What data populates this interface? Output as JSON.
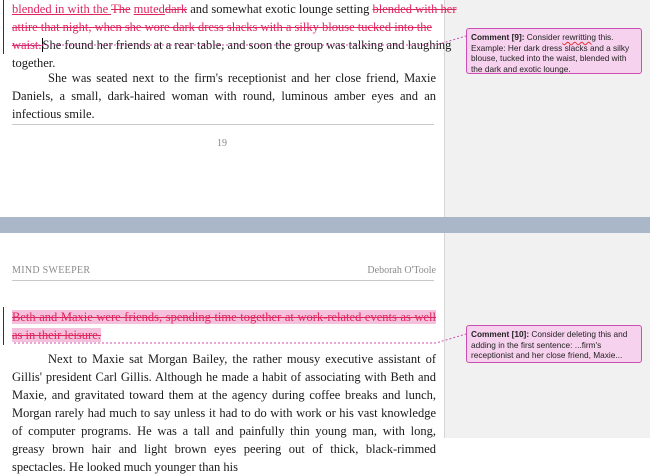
{
  "page1": {
    "line1": {
      "pre_ins": "blended in with the ",
      "del_the": "The",
      "sp": " ",
      "ins_muted": "muted",
      "del_dark": "dark",
      "rest": " and somewhat exotic lounge setting",
      "del_tail": "blended with her"
    },
    "line2_del": "attire that night, when she wore dark dress slacks with a silky blouse tucked into the",
    "line3": {
      "del": "waist.",
      "text": "She found her friends at a rear table, and soon the group was talking and laughing"
    },
    "line4": "together.",
    "para2": "She was seated next to the firm's receptionist and her close friend, Maxie Daniels, a small, dark-haired woman with round, luminous amber eyes and an infectious smile.",
    "page_number": "19"
  },
  "page2": {
    "header_left": "MIND SWEEPER",
    "header_right": "Deborah O'Toole",
    "deleted_para": "Beth and Maxie were friends, spending time together at work-related events as well as in their leisure.",
    "para": "Next to Maxie sat Morgan Bailey, the rather mousy executive assistant of Gillis' president Carl Gillis. Although he made a habit of associating with Beth and Maxie, and gravitated toward them at the agency during coffee breaks and lunch, Morgan rarely had much to say unless it had to do with work or his vast knowledge of computer programs. He was a tall and painfully thin young man, with long, greasy brown hair and light brown eyes peering out of thick, black-rimmed spectacles. He looked much younger than his"
  },
  "comments": [
    {
      "label": "Comment [9]:",
      "pre": " Consider ",
      "squiggle": "rewritting",
      "post": " this. Example: Her dark dress slacks and a silky blouse, tucked into the waist, blended with the dark and exotic lounge."
    },
    {
      "label": "Comment [10]:",
      "text": " Consider deleting this and adding in the first sentence: ...firm's receptionist and her close friend, Maxie..."
    }
  ],
  "colors": {
    "revision": "#e0245e",
    "comment_fill": "#f7d2ee",
    "comment_border": "#c94fb0",
    "page_gap": "#a9b7c9"
  }
}
